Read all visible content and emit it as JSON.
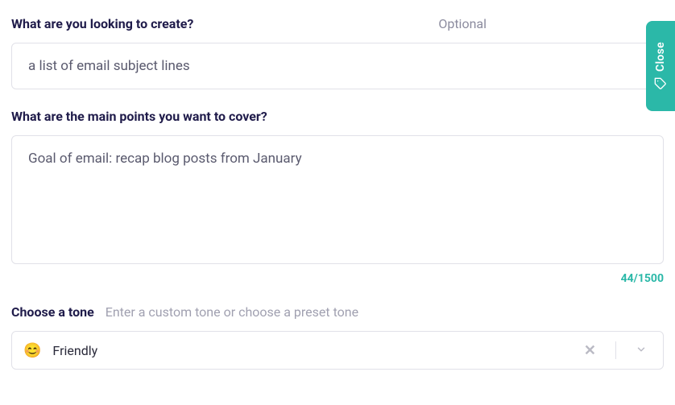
{
  "field1": {
    "label": "What are you looking to create?",
    "optional": "Optional",
    "value": "a list of email subject lines"
  },
  "field2": {
    "label": "What are the main points you want to cover?",
    "value": "Goal of email: recap blog posts from January",
    "char_count": "44/1500"
  },
  "tone": {
    "label": "Choose a tone",
    "hint": "Enter a custom tone or choose a preset tone",
    "emoji": "😊",
    "value": "Friendly"
  },
  "close": {
    "label": "Close"
  }
}
